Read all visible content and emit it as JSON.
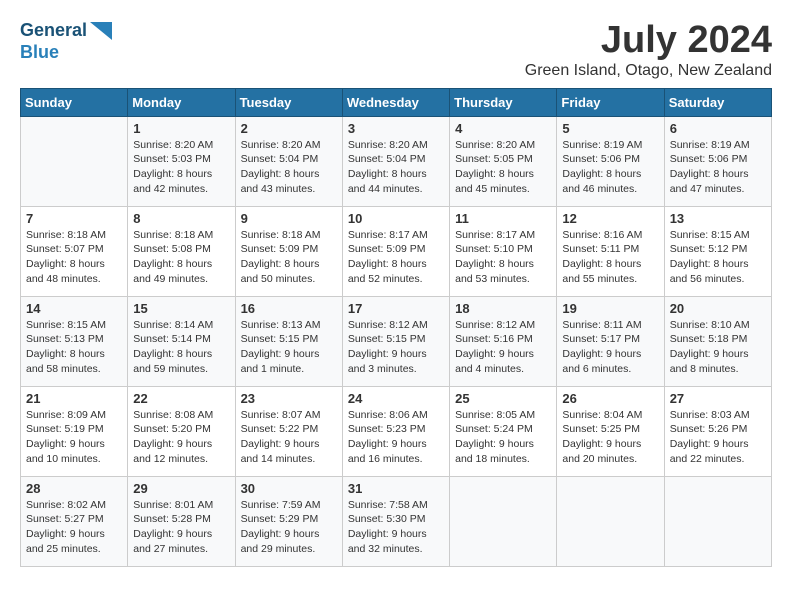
{
  "header": {
    "logo_line1": "General",
    "logo_line2": "Blue",
    "month_title": "July 2024",
    "location": "Green Island, Otago, New Zealand"
  },
  "days_of_week": [
    "Sunday",
    "Monday",
    "Tuesday",
    "Wednesday",
    "Thursday",
    "Friday",
    "Saturday"
  ],
  "weeks": [
    [
      {
        "day": "",
        "sunrise": "",
        "sunset": "",
        "daylight": ""
      },
      {
        "day": "1",
        "sunrise": "Sunrise: 8:20 AM",
        "sunset": "Sunset: 5:03 PM",
        "daylight": "Daylight: 8 hours and 42 minutes."
      },
      {
        "day": "2",
        "sunrise": "Sunrise: 8:20 AM",
        "sunset": "Sunset: 5:04 PM",
        "daylight": "Daylight: 8 hours and 43 minutes."
      },
      {
        "day": "3",
        "sunrise": "Sunrise: 8:20 AM",
        "sunset": "Sunset: 5:04 PM",
        "daylight": "Daylight: 8 hours and 44 minutes."
      },
      {
        "day": "4",
        "sunrise": "Sunrise: 8:20 AM",
        "sunset": "Sunset: 5:05 PM",
        "daylight": "Daylight: 8 hours and 45 minutes."
      },
      {
        "day": "5",
        "sunrise": "Sunrise: 8:19 AM",
        "sunset": "Sunset: 5:06 PM",
        "daylight": "Daylight: 8 hours and 46 minutes."
      },
      {
        "day": "6",
        "sunrise": "Sunrise: 8:19 AM",
        "sunset": "Sunset: 5:06 PM",
        "daylight": "Daylight: 8 hours and 47 minutes."
      }
    ],
    [
      {
        "day": "7",
        "sunrise": "Sunrise: 8:18 AM",
        "sunset": "Sunset: 5:07 PM",
        "daylight": "Daylight: 8 hours and 48 minutes."
      },
      {
        "day": "8",
        "sunrise": "Sunrise: 8:18 AM",
        "sunset": "Sunset: 5:08 PM",
        "daylight": "Daylight: 8 hours and 49 minutes."
      },
      {
        "day": "9",
        "sunrise": "Sunrise: 8:18 AM",
        "sunset": "Sunset: 5:09 PM",
        "daylight": "Daylight: 8 hours and 50 minutes."
      },
      {
        "day": "10",
        "sunrise": "Sunrise: 8:17 AM",
        "sunset": "Sunset: 5:09 PM",
        "daylight": "Daylight: 8 hours and 52 minutes."
      },
      {
        "day": "11",
        "sunrise": "Sunrise: 8:17 AM",
        "sunset": "Sunset: 5:10 PM",
        "daylight": "Daylight: 8 hours and 53 minutes."
      },
      {
        "day": "12",
        "sunrise": "Sunrise: 8:16 AM",
        "sunset": "Sunset: 5:11 PM",
        "daylight": "Daylight: 8 hours and 55 minutes."
      },
      {
        "day": "13",
        "sunrise": "Sunrise: 8:15 AM",
        "sunset": "Sunset: 5:12 PM",
        "daylight": "Daylight: 8 hours and 56 minutes."
      }
    ],
    [
      {
        "day": "14",
        "sunrise": "Sunrise: 8:15 AM",
        "sunset": "Sunset: 5:13 PM",
        "daylight": "Daylight: 8 hours and 58 minutes."
      },
      {
        "day": "15",
        "sunrise": "Sunrise: 8:14 AM",
        "sunset": "Sunset: 5:14 PM",
        "daylight": "Daylight: 8 hours and 59 minutes."
      },
      {
        "day": "16",
        "sunrise": "Sunrise: 8:13 AM",
        "sunset": "Sunset: 5:15 PM",
        "daylight": "Daylight: 9 hours and 1 minute."
      },
      {
        "day": "17",
        "sunrise": "Sunrise: 8:12 AM",
        "sunset": "Sunset: 5:15 PM",
        "daylight": "Daylight: 9 hours and 3 minutes."
      },
      {
        "day": "18",
        "sunrise": "Sunrise: 8:12 AM",
        "sunset": "Sunset: 5:16 PM",
        "daylight": "Daylight: 9 hours and 4 minutes."
      },
      {
        "day": "19",
        "sunrise": "Sunrise: 8:11 AM",
        "sunset": "Sunset: 5:17 PM",
        "daylight": "Daylight: 9 hours and 6 minutes."
      },
      {
        "day": "20",
        "sunrise": "Sunrise: 8:10 AM",
        "sunset": "Sunset: 5:18 PM",
        "daylight": "Daylight: 9 hours and 8 minutes."
      }
    ],
    [
      {
        "day": "21",
        "sunrise": "Sunrise: 8:09 AM",
        "sunset": "Sunset: 5:19 PM",
        "daylight": "Daylight: 9 hours and 10 minutes."
      },
      {
        "day": "22",
        "sunrise": "Sunrise: 8:08 AM",
        "sunset": "Sunset: 5:20 PM",
        "daylight": "Daylight: 9 hours and 12 minutes."
      },
      {
        "day": "23",
        "sunrise": "Sunrise: 8:07 AM",
        "sunset": "Sunset: 5:22 PM",
        "daylight": "Daylight: 9 hours and 14 minutes."
      },
      {
        "day": "24",
        "sunrise": "Sunrise: 8:06 AM",
        "sunset": "Sunset: 5:23 PM",
        "daylight": "Daylight: 9 hours and 16 minutes."
      },
      {
        "day": "25",
        "sunrise": "Sunrise: 8:05 AM",
        "sunset": "Sunset: 5:24 PM",
        "daylight": "Daylight: 9 hours and 18 minutes."
      },
      {
        "day": "26",
        "sunrise": "Sunrise: 8:04 AM",
        "sunset": "Sunset: 5:25 PM",
        "daylight": "Daylight: 9 hours and 20 minutes."
      },
      {
        "day": "27",
        "sunrise": "Sunrise: 8:03 AM",
        "sunset": "Sunset: 5:26 PM",
        "daylight": "Daylight: 9 hours and 22 minutes."
      }
    ],
    [
      {
        "day": "28",
        "sunrise": "Sunrise: 8:02 AM",
        "sunset": "Sunset: 5:27 PM",
        "daylight": "Daylight: 9 hours and 25 minutes."
      },
      {
        "day": "29",
        "sunrise": "Sunrise: 8:01 AM",
        "sunset": "Sunset: 5:28 PM",
        "daylight": "Daylight: 9 hours and 27 minutes."
      },
      {
        "day": "30",
        "sunrise": "Sunrise: 7:59 AM",
        "sunset": "Sunset: 5:29 PM",
        "daylight": "Daylight: 9 hours and 29 minutes."
      },
      {
        "day": "31",
        "sunrise": "Sunrise: 7:58 AM",
        "sunset": "Sunset: 5:30 PM",
        "daylight": "Daylight: 9 hours and 32 minutes."
      },
      {
        "day": "",
        "sunrise": "",
        "sunset": "",
        "daylight": ""
      },
      {
        "day": "",
        "sunrise": "",
        "sunset": "",
        "daylight": ""
      },
      {
        "day": "",
        "sunrise": "",
        "sunset": "",
        "daylight": ""
      }
    ]
  ]
}
